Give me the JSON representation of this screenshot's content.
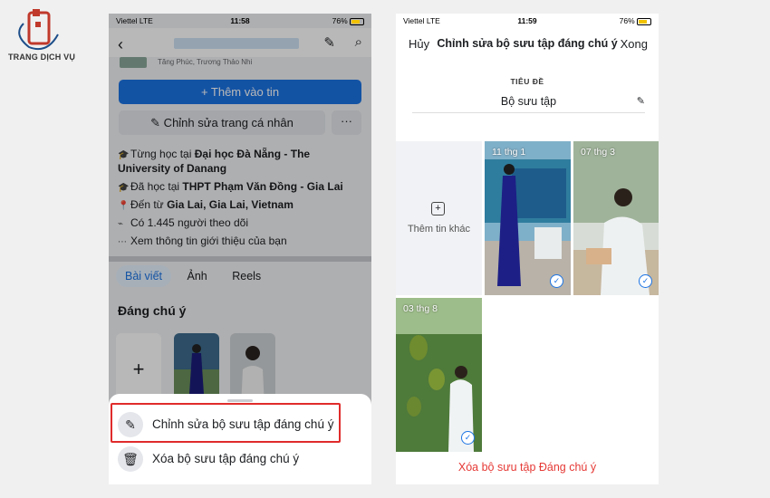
{
  "brand": {
    "logo_text": "TRANG DỊCH VỤ"
  },
  "left_phone": {
    "status": {
      "carrier": "Viettel",
      "network": "LTE",
      "time": "11:58",
      "battery": "76%"
    },
    "friends_line": "Tăng Phúc, Trương Thảo Nhi",
    "add_story_label": "+ Thêm vào tin",
    "edit_profile_label": "✎ Chỉnh sửa trang cá nhân",
    "more_label": "···",
    "info": [
      {
        "icon": "graduation-cap-icon",
        "prefix": "Từng học tại ",
        "bold": "Đại học Đà Nẵng - The University of Danang"
      },
      {
        "icon": "graduation-cap-icon",
        "prefix": "Đã học tại ",
        "bold": "THPT Phạm Văn Đồng - Gia Lai"
      },
      {
        "icon": "location-pin-icon",
        "prefix": "Đến từ ",
        "bold": "Gia Lai, Gia Lai, Vietnam"
      },
      {
        "icon": "rss-icon",
        "prefix": "Có 1.445 người theo dõi",
        "bold": ""
      },
      {
        "icon": "more-dots-icon",
        "prefix": "Xem thông tin giới thiệu của bạn",
        "bold": ""
      }
    ],
    "tabs": [
      "Bài viết",
      "Ảnh",
      "Reels"
    ],
    "featured_title": "Đáng chú ý",
    "add_tile_label": "+",
    "sheet": {
      "edit_label": "Chỉnh sửa bộ sưu tập đáng chú ý",
      "delete_label": "Xóa bộ sưu tập đáng chú ý"
    }
  },
  "right_phone": {
    "status": {
      "carrier": "Viettel",
      "network": "LTE",
      "time": "11:59",
      "battery": "76%"
    },
    "header": {
      "cancel": "Hủy",
      "title": "Chỉnh sửa bộ sưu tập đáng chú ý",
      "done": "Xong"
    },
    "title_label": "TIÊU ĐỀ",
    "title_value": "Bộ sưu tập",
    "add_more_label": "Thêm tin khác",
    "stories": [
      {
        "date": "11 thg 1",
        "selected": true
      },
      {
        "date": "07 thg 3",
        "selected": true
      },
      {
        "date": "03 thg 8",
        "selected": true
      }
    ],
    "delete_label": "Xóa bộ sưu tập Đáng chú ý",
    "colors": {
      "accent": "#1b74e4",
      "delete": "#e53935"
    }
  }
}
